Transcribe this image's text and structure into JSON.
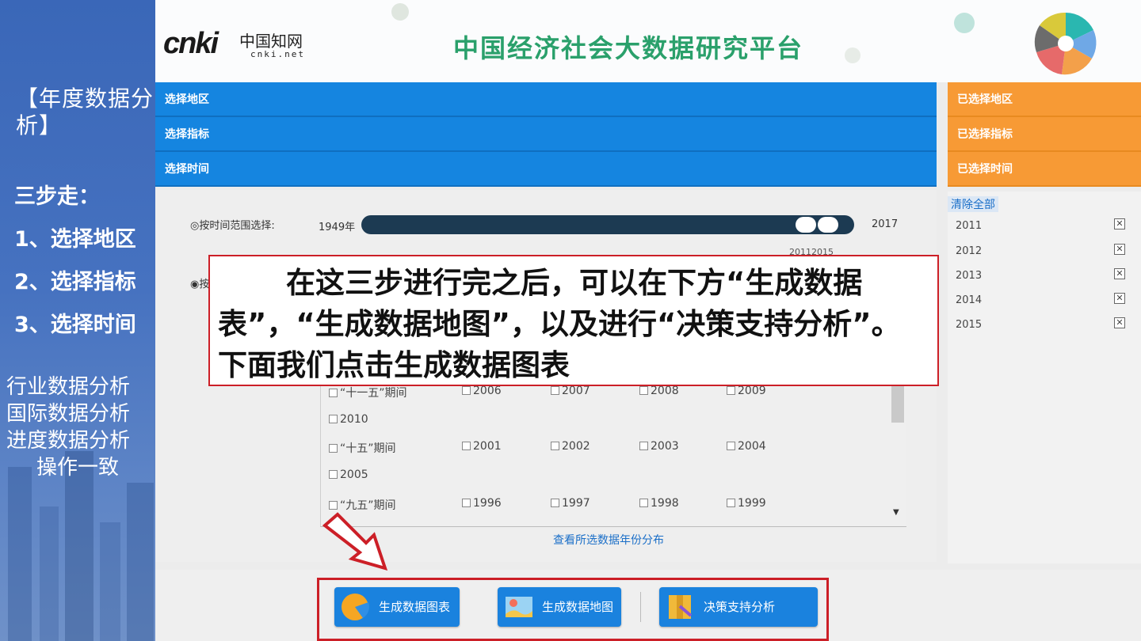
{
  "slide": {
    "title": "【年度数据分析】",
    "steps_heading": "三步走：",
    "steps": [
      "1、选择地区",
      "2、选择指标",
      "3、选择时间"
    ],
    "others": [
      "行业数据分析",
      "国际数据分析",
      "进度数据分析",
      "操作一致"
    ]
  },
  "header": {
    "logo_text": "cnki",
    "logo_cn": "中国知网",
    "logo_url": "cnki.net",
    "platform_title": "中国经济社会大数据研究平台"
  },
  "sections": {
    "select_region": "选择地区",
    "select_indicator": "选择指标",
    "select_time": "选择时间",
    "selected_region": "已选择地区",
    "selected_indicator": "已选择指标",
    "selected_time": "已选择时间"
  },
  "time_range": {
    "radio_label": "按时间范围选择:",
    "start": "1949年",
    "end": "2017",
    "range_label": "20112015",
    "radio2_label": "按"
  },
  "year_list": {
    "rows": [
      {
        "period": "“十一五”期间",
        "years": [
          "2006",
          "2007",
          "2008",
          "2009"
        ],
        "extra": "2010"
      },
      {
        "period": "“十五”期间",
        "years": [
          "2001",
          "2002",
          "2003",
          "2004"
        ],
        "extra": "2005"
      },
      {
        "period": "“九五”期间",
        "years": [
          "1996",
          "1997",
          "1998",
          "1999"
        ],
        "extra": ""
      }
    ],
    "view_distribution": "查看所选数据年份分布"
  },
  "selected": {
    "clear_all": "清除全部",
    "years": [
      "2011",
      "2012",
      "2013",
      "2014",
      "2015"
    ]
  },
  "buttons": {
    "generate_table": "生成数据图表",
    "generate_map": "生成数据地图",
    "decision_support": "决策支持分析"
  },
  "callout": {
    "text": "在这三步进行完之后，可以在下方“生成数据表”，“生成数据地图”，以及进行“决策支持分析”。下面我们点击生成数据图表"
  },
  "colors": {
    "blue_bar": "#1585e0",
    "orange_bar": "#f79a35",
    "title_green": "#2aa06b",
    "highlight_red": "#cc1f27"
  }
}
